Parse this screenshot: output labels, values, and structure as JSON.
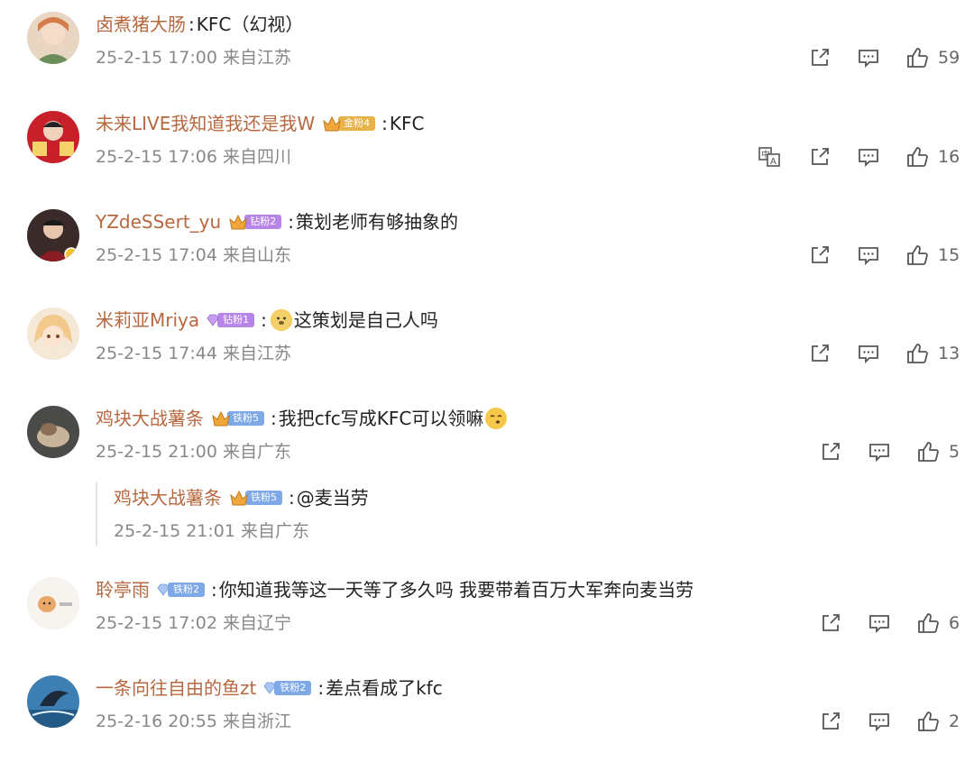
{
  "comments": [
    {
      "username": "卤煮猪大肠",
      "badge": null,
      "text": "KFC（幻视）",
      "time": "25-2-15 17:00",
      "location": "来自江苏",
      "likes": "59",
      "translate": false
    },
    {
      "username": "未来LIVE我知道我还是我W",
      "badge": {
        "label": "金粉4",
        "color": "#e8b24a"
      },
      "text": "KFC",
      "time": "25-2-15 17:06",
      "location": "来自四川",
      "likes": "16",
      "translate": true
    },
    {
      "username": "YZdeSSert_yu",
      "badge": {
        "label": "钻粉2",
        "color": "#b784e8"
      },
      "text": "策划老师有够抽象的",
      "time": "25-2-15 17:04",
      "location": "来自山东",
      "likes": "15",
      "translate": false
    },
    {
      "username": "米莉亚Mriya",
      "badge": {
        "label": "钻粉1",
        "color": "#b784e8"
      },
      "text": "这策划是自己人吗",
      "time": "25-2-15 17:44",
      "location": "来自江苏",
      "likes": "13",
      "translate": false
    },
    {
      "username": "鸡块大战薯条",
      "badge": {
        "label": "铁粉5",
        "color": "#7ea8e6"
      },
      "text": "我把cfc写成KFC可以领嘛",
      "time": "25-2-15 21:00",
      "location": "来自广东",
      "likes": "5",
      "translate": false,
      "reply": {
        "username": "鸡块大战薯条",
        "badge": {
          "label": "铁粉5",
          "color": "#7ea8e6"
        },
        "text": "@麦当劳",
        "time": "25-2-15 21:01",
        "location": "来自广东"
      }
    },
    {
      "username": "聆亭雨",
      "badge": {
        "label": "铁粉2",
        "color": "#7ea8e6"
      },
      "text": "你知道我等这一天等了多久吗 我要带着百万大军奔向麦当劳",
      "time": "25-2-15 17:02",
      "location": "来自辽宁",
      "likes": "6",
      "translate": false
    },
    {
      "username": "一条向往自由的鱼zt",
      "badge": {
        "label": "铁粉2",
        "color": "#7ea8e6"
      },
      "text": "差点看成了kfc",
      "time": "25-2-16 20:55",
      "location": "来自浙江",
      "likes": "2",
      "translate": false
    }
  ],
  "icons": {
    "share": "share-icon",
    "comment": "comment-icon",
    "like": "thumbs-up-icon",
    "translate": "translate-icon"
  },
  "colors": {
    "username": "#b7683f",
    "meta": "#888888"
  }
}
